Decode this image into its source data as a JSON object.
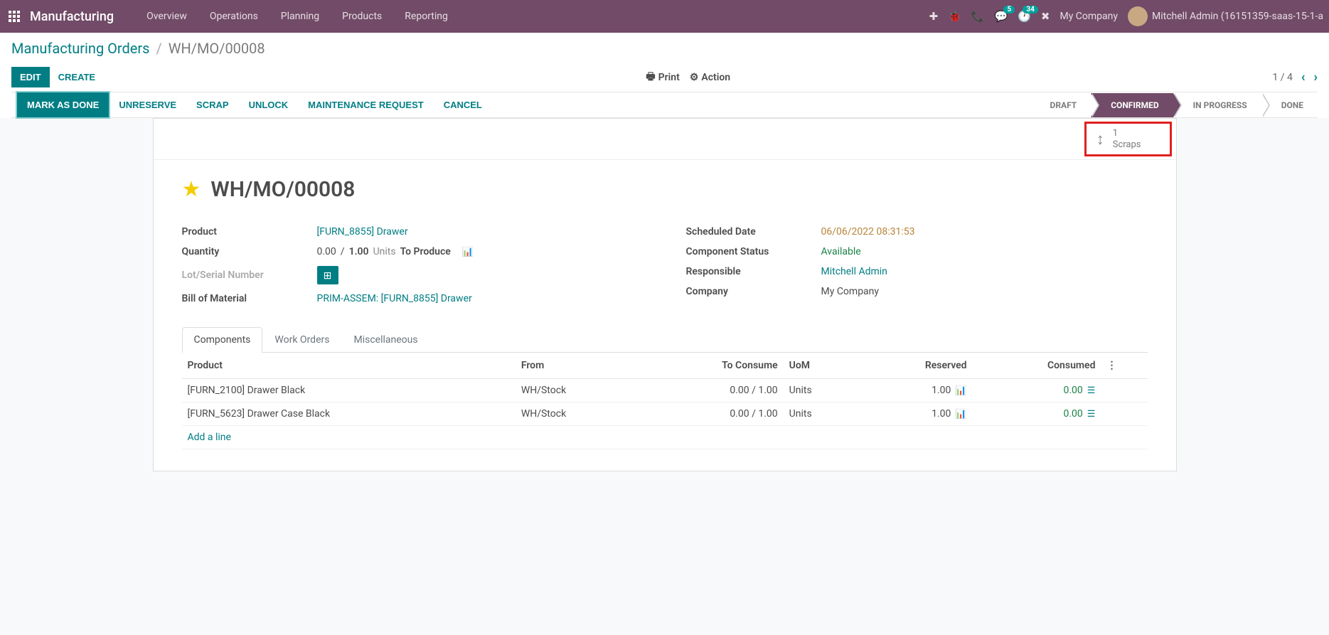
{
  "nav": {
    "brand": "Manufacturing",
    "menu": [
      "Overview",
      "Operations",
      "Planning",
      "Products",
      "Reporting"
    ],
    "company": "My Company",
    "user": "Mitchell Admin (16151359-saas-15-1-a",
    "msg_badge": "5",
    "activity_badge": "34"
  },
  "breadcrumb": {
    "parent": "Manufacturing Orders",
    "current": "WH/MO/00008"
  },
  "buttons": {
    "edit": "EDIT",
    "create": "CREATE",
    "print": "Print",
    "action": "Action"
  },
  "pager": {
    "text": "1 / 4"
  },
  "statusbar": {
    "actions": [
      "MARK AS DONE",
      "UNRESERVE",
      "SCRAP",
      "UNLOCK",
      "MAINTENANCE REQUEST",
      "CANCEL"
    ],
    "stages": [
      "DRAFT",
      "CONFIRMED",
      "IN PROGRESS",
      "DONE"
    ],
    "active_stage": "CONFIRMED"
  },
  "stat": {
    "count": "1",
    "label": "Scraps"
  },
  "title": "WH/MO/00008",
  "fields": {
    "product_label": "Product",
    "product_val": "[FURN_8855] Drawer",
    "qty_label": "Quantity",
    "qty_done": "0.00",
    "qty_sep": "/",
    "qty_total": "1.00",
    "qty_uom": "Units",
    "qty_suffix": "To Produce",
    "lot_label": "Lot/Serial Number",
    "bom_label": "Bill of Material",
    "bom_val": "PRIM-ASSEM: [FURN_8855] Drawer",
    "sched_label": "Scheduled Date",
    "sched_val": "06/06/2022 08:31:53",
    "comp_label": "Component Status",
    "comp_val": "Available",
    "resp_label": "Responsible",
    "resp_val": "Mitchell Admin",
    "company_label": "Company",
    "company_val": "My Company"
  },
  "tabs": [
    "Components",
    "Work Orders",
    "Miscellaneous"
  ],
  "table": {
    "headers": {
      "product": "Product",
      "from": "From",
      "toconsume": "To Consume",
      "uom": "UoM",
      "reserved": "Reserved",
      "consumed": "Consumed"
    },
    "rows": [
      {
        "product": "[FURN_2100] Drawer Black",
        "from": "WH/Stock",
        "toconsume": "0.00 / 1.00",
        "uom": "Units",
        "reserved": "1.00",
        "consumed": "0.00"
      },
      {
        "product": "[FURN_5623] Drawer Case Black",
        "from": "WH/Stock",
        "toconsume": "0.00 / 1.00",
        "uom": "Units",
        "reserved": "1.00",
        "consumed": "0.00"
      }
    ],
    "addline": "Add a line"
  }
}
